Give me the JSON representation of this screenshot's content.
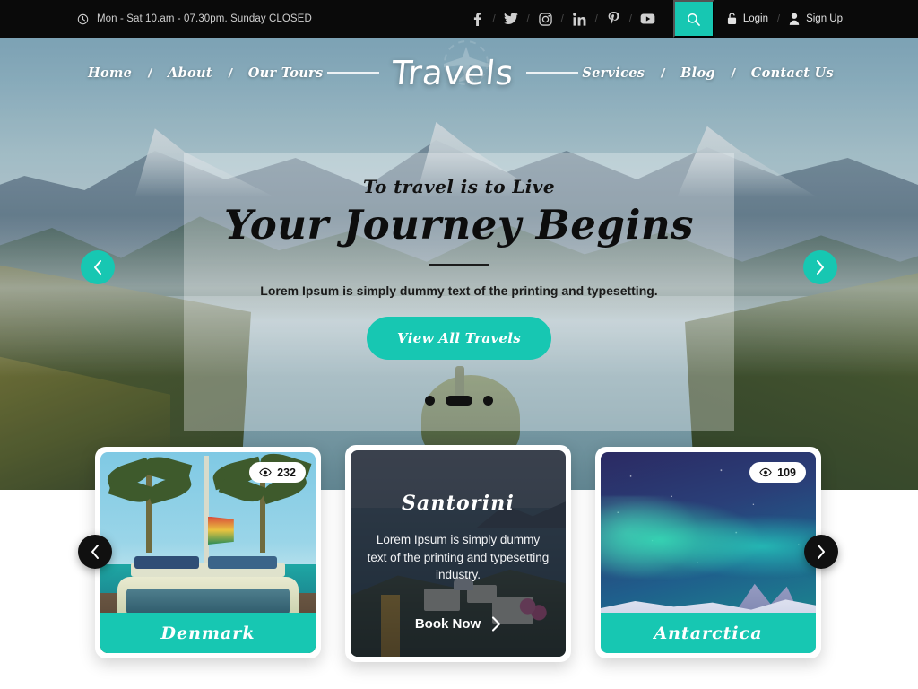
{
  "topbar": {
    "hours": "Mon - Sat 10.am - 07.30pm. Sunday CLOSED",
    "clock_icon": "clock-icon",
    "socials": [
      {
        "name": "facebook",
        "glyph": "f"
      },
      {
        "name": "twitter",
        "glyph": "t"
      },
      {
        "name": "instagram",
        "glyph": "ig"
      },
      {
        "name": "linkedin",
        "glyph": "in"
      },
      {
        "name": "pinterest",
        "glyph": "p"
      },
      {
        "name": "youtube",
        "glyph": "yt"
      }
    ],
    "separator": "/",
    "search_icon": "search-icon",
    "login_label": "Login",
    "login_icon": "lock-icon",
    "signup_label": "Sign Up",
    "signup_icon": "user-icon",
    "auth_separator": "/",
    "accent_color": "#17c7b2",
    "background_color": "#0a0a0a"
  },
  "nav": {
    "left": [
      {
        "label": "Home"
      },
      {
        "label": "About"
      },
      {
        "label": "Our Tours"
      }
    ],
    "right": [
      {
        "label": "Services"
      },
      {
        "label": "Blog"
      },
      {
        "label": "Contact Us"
      }
    ],
    "separator": "/",
    "brand": "Travels",
    "brand_icon": "airplane-icon"
  },
  "hero": {
    "kicker": "To travel is to Live",
    "title": "Your Journey Begins",
    "subtitle": "Lorem Ipsum is simply dummy text of the printing and typesetting.",
    "cta_label": "View All Travels",
    "prev_icon": "chevron-left-icon",
    "next_icon": "chevron-right-icon",
    "slides": 3,
    "active_slide": 2,
    "accent_color": "#17c7b2"
  },
  "cards": {
    "prev_icon": "chevron-left-icon",
    "next_icon": "chevron-right-icon",
    "items": [
      {
        "title": "Denmark",
        "views": "232",
        "views_icon": "eye-icon",
        "state": "default"
      },
      {
        "title": "Santorini",
        "description": "Lorem Ipsum is simply dummy text of the printing and typesetting industry.",
        "book_label": "Book Now",
        "book_icon": "chevron-right-icon",
        "state": "active"
      },
      {
        "title": "Antarctica",
        "views": "109",
        "views_icon": "eye-icon",
        "state": "default"
      }
    ]
  }
}
